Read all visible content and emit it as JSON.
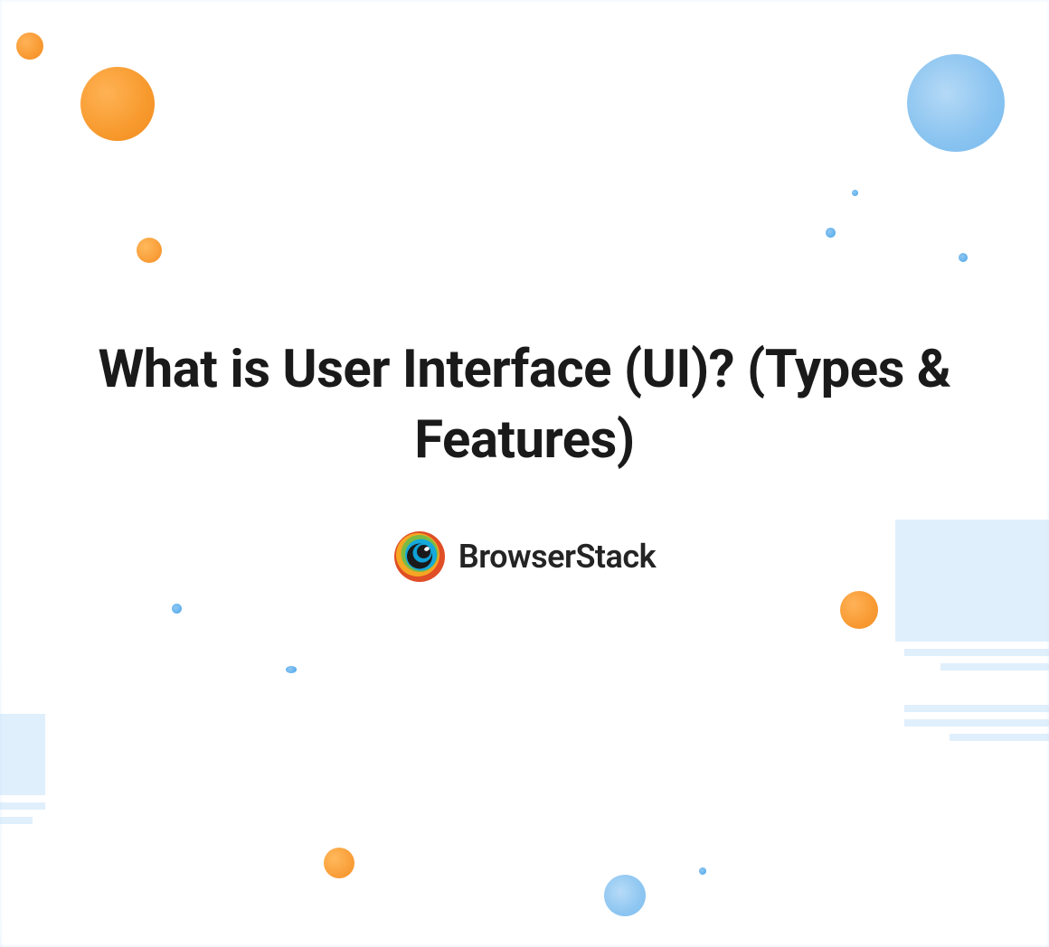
{
  "title": "What is User Interface (UI)? (Types & Features)",
  "brand": {
    "name": "BrowserStack",
    "icon": "browserstack-logo-icon"
  },
  "colors": {
    "bg_light_blue": "#e6f2fd",
    "orange": "#f79a2e",
    "blue_circle": "#89c3f0",
    "text": "#1a1a1a"
  }
}
